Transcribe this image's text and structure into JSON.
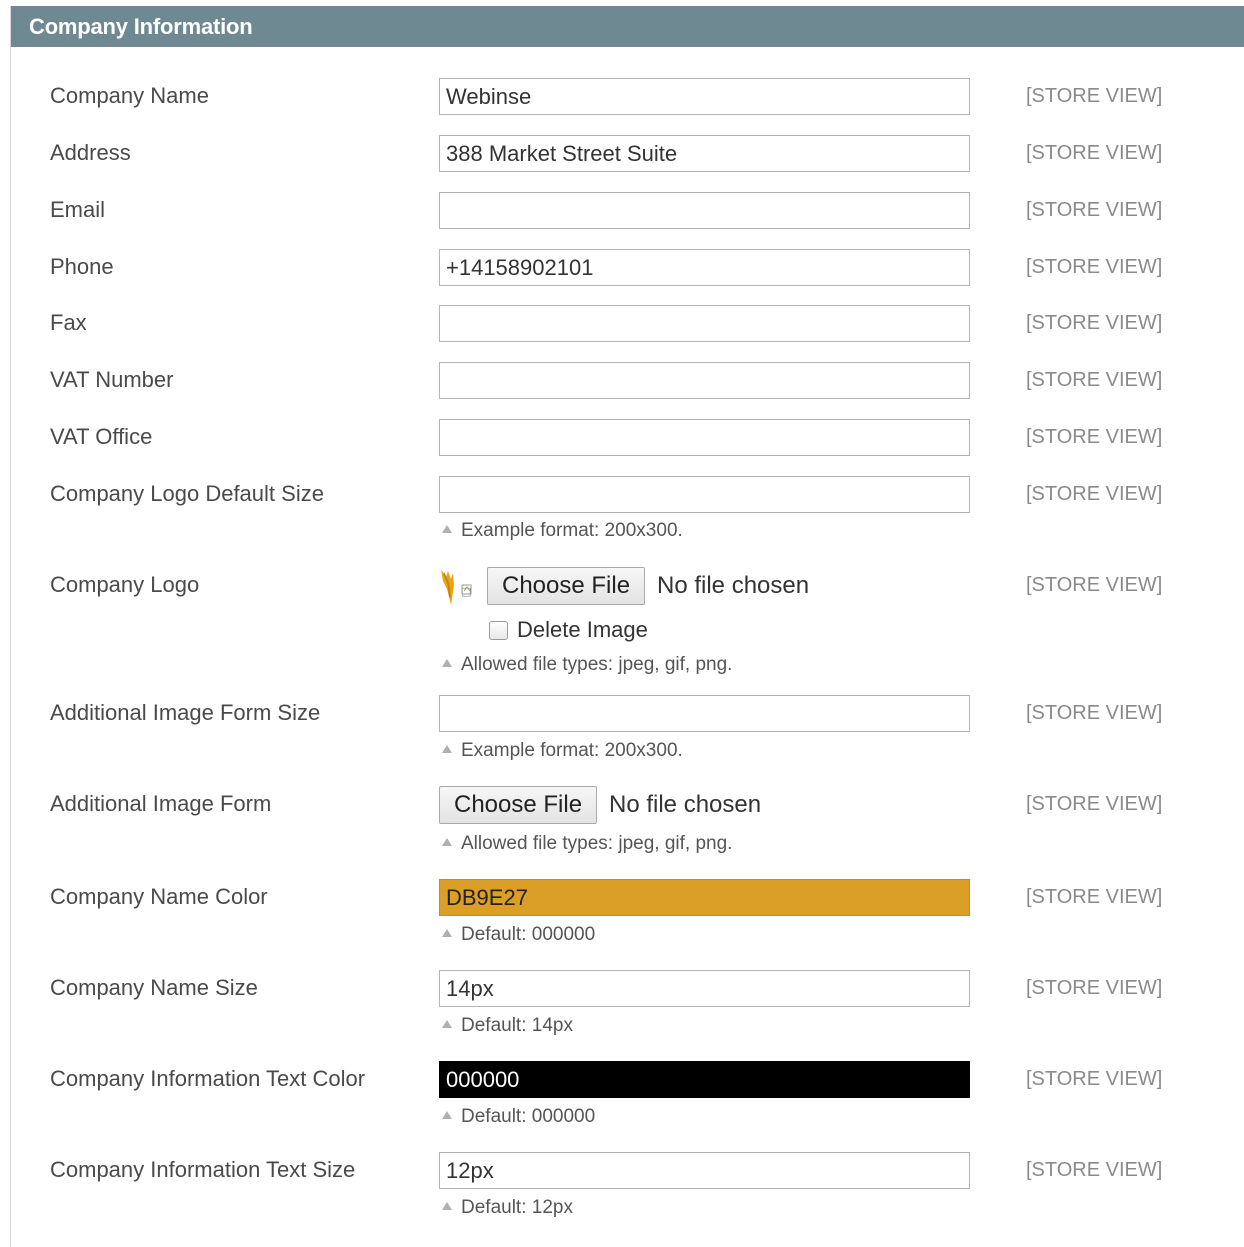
{
  "header": {
    "title": "Company Information"
  },
  "scope_label": "[STORE VIEW]",
  "fields": {
    "company_name": {
      "label": "Company Name",
      "value": "Webinse"
    },
    "address": {
      "label": "Address",
      "value": "388 Market Street Suite"
    },
    "email": {
      "label": "Email",
      "value": ""
    },
    "phone": {
      "label": "Phone",
      "value": "+14158902101"
    },
    "fax": {
      "label": "Fax",
      "value": ""
    },
    "vat_number": {
      "label": "VAT Number",
      "value": ""
    },
    "vat_office": {
      "label": "VAT Office",
      "value": ""
    },
    "logo_size": {
      "label": "Company Logo Default Size",
      "value": "",
      "note": "Example format: 200x300."
    },
    "logo": {
      "label": "Company Logo",
      "button": "Choose File",
      "status": "No file chosen",
      "delete_label": "Delete Image",
      "delete_checked": false,
      "note": "Allowed file types: jpeg, gif, png.",
      "thumbnail_icon": "broken-image-icon"
    },
    "additional_size": {
      "label": "Additional Image Form Size",
      "value": "",
      "note": "Example format: 200x300."
    },
    "additional_image": {
      "label": "Additional Image Form",
      "button": "Choose File",
      "status": "No file chosen",
      "note": "Allowed file types: jpeg, gif, png."
    },
    "name_color": {
      "label": "Company Name Color",
      "value": "DB9E27",
      "note": "Default: 000000",
      "swatch": "#DB9E27"
    },
    "name_size": {
      "label": "Company Name Size",
      "value": "14px",
      "note": "Default: 14px"
    },
    "info_text_color": {
      "label": "Company Information Text Color",
      "value": "000000",
      "note": "Default: 000000",
      "swatch": "#000000"
    },
    "info_text_size": {
      "label": "Company Information Text Size",
      "value": "12px",
      "note": "Default: 12px"
    }
  }
}
